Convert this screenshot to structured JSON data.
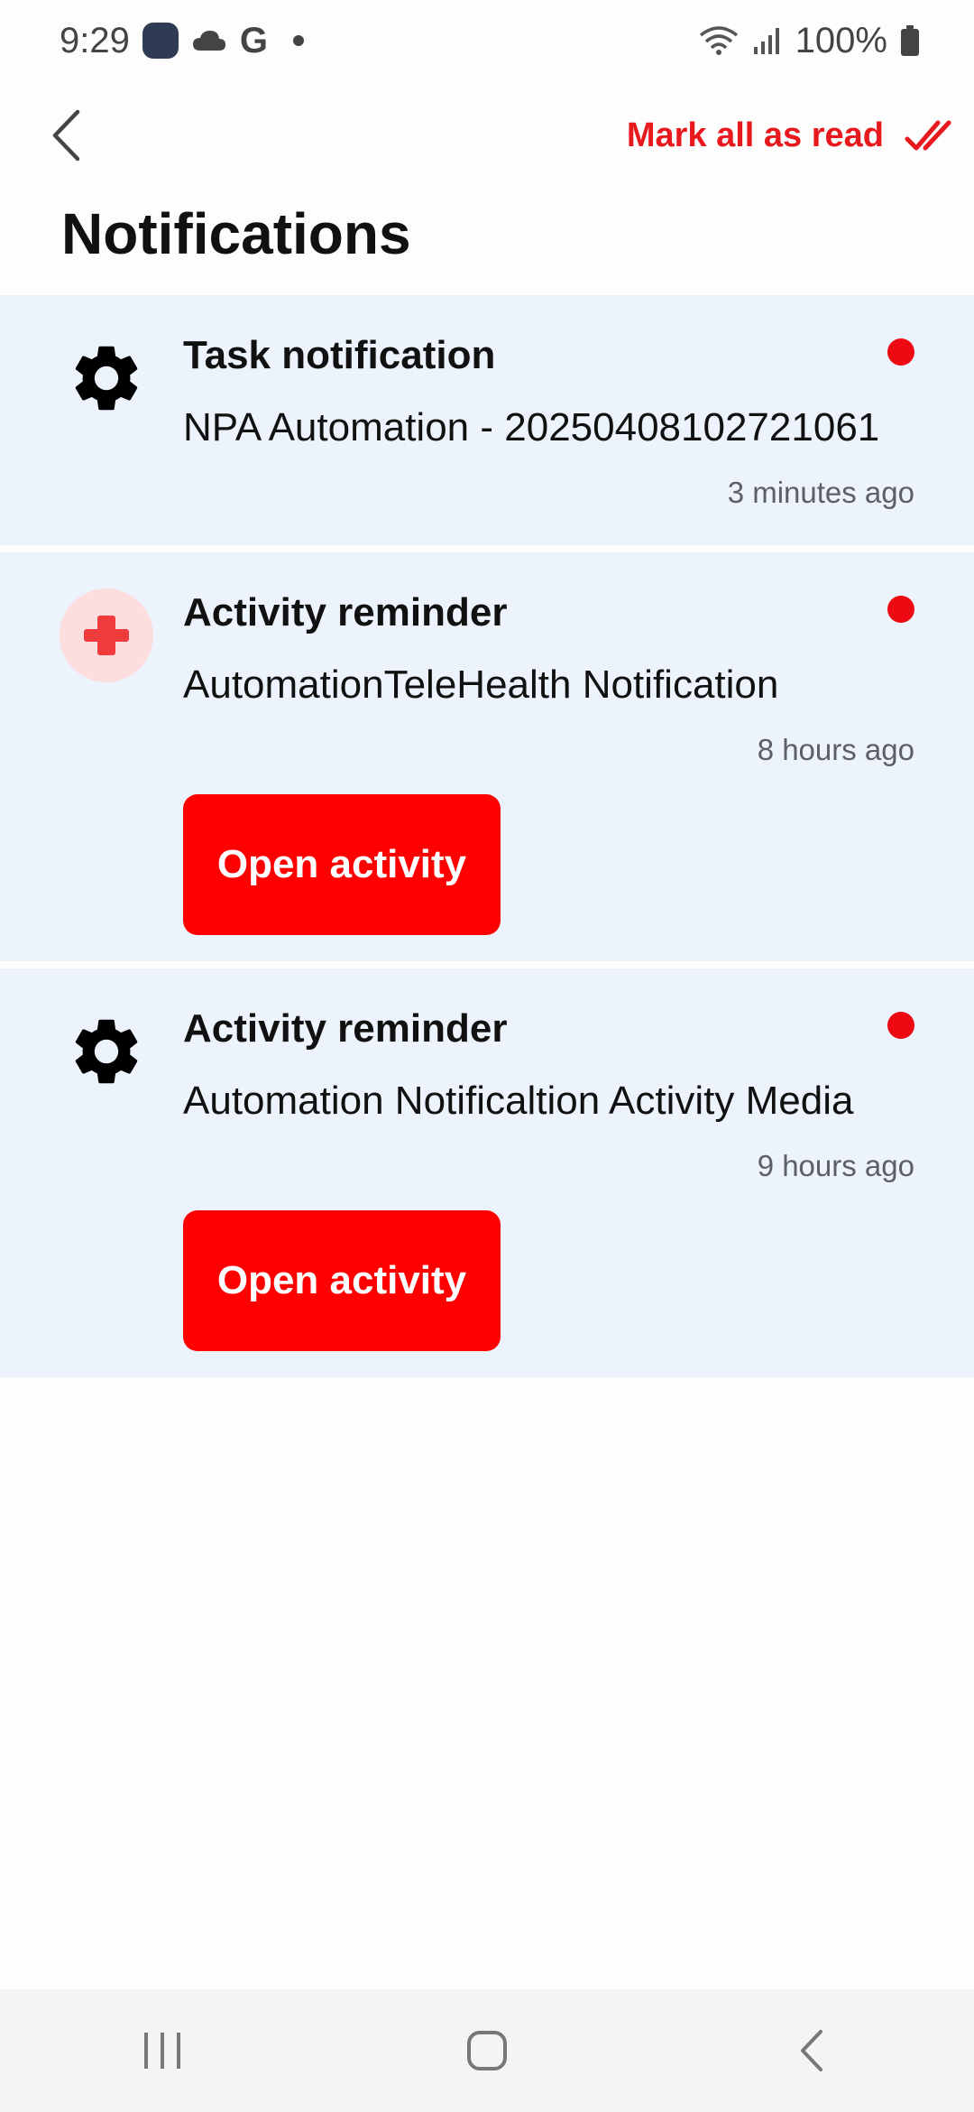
{
  "status_bar": {
    "time": "9:29",
    "battery": "100%",
    "icons": [
      "app-icon",
      "cloud-icon",
      "google-icon",
      "dot-icon",
      "wifi-icon",
      "signal-icon",
      "battery-icon"
    ]
  },
  "header": {
    "mark_all_label": "Mark all as read",
    "title": "Notifications"
  },
  "notifications": [
    {
      "icon": "gear-icon",
      "title": "Task notification",
      "body": "NPA Automation - 20250408102721061",
      "time": "3 minutes ago",
      "unread": true
    },
    {
      "icon": "medical-cross-icon",
      "title": "Activity reminder",
      "body": "AutomationTeleHealth Notification",
      "time": "8 hours ago",
      "unread": true,
      "action_label": "Open activity"
    },
    {
      "icon": "gear-icon",
      "title": "Activity reminder",
      "body": "Automation Notificaltion Activity Media",
      "time": "9 hours ago",
      "unread": true,
      "action_label": "Open activity"
    }
  ],
  "colors": {
    "accent": "#ff0000",
    "card_bg": "#edf3fc",
    "unread_dot": "#ee0a12",
    "health_icon_bg": "#fcdede"
  },
  "nav_bar": {
    "icons": [
      "recent-apps-icon",
      "home-icon",
      "back-icon"
    ]
  }
}
